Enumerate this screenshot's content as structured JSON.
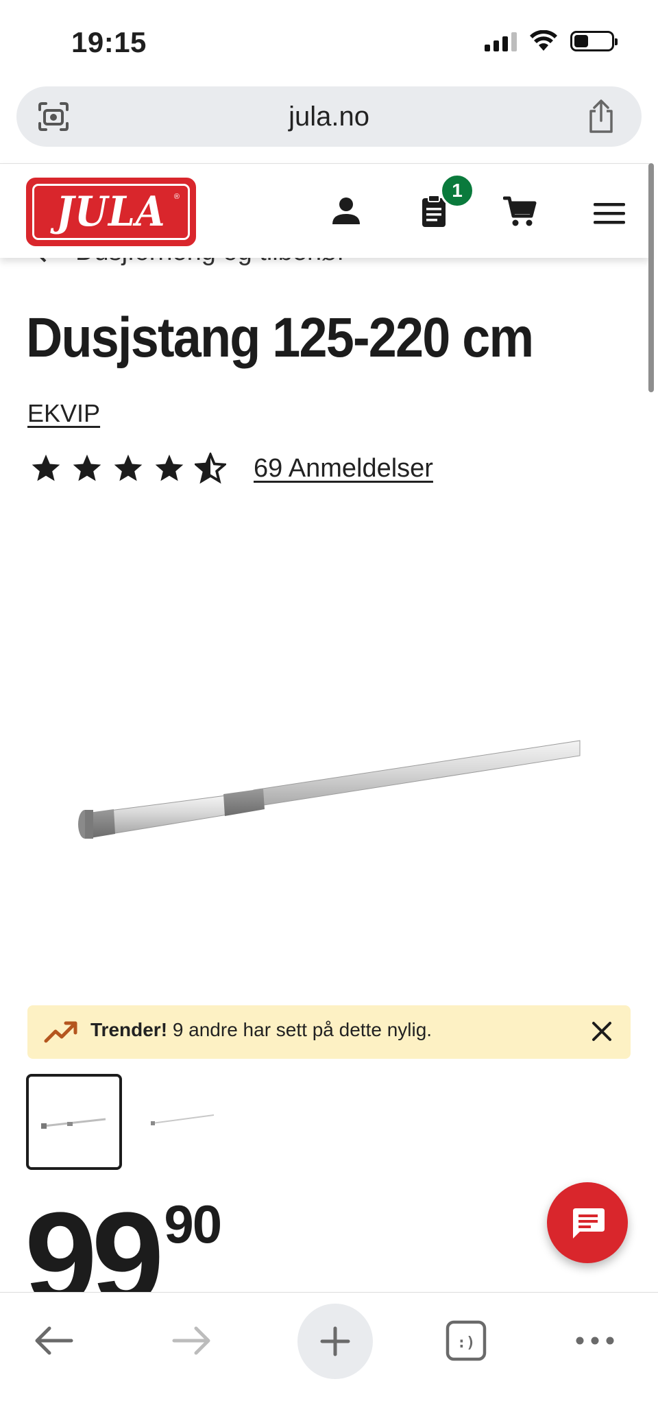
{
  "status": {
    "time": "19:15"
  },
  "browser": {
    "url": "jula.no"
  },
  "header": {
    "logo_text": "JULA",
    "list_badge_count": "1"
  },
  "breadcrumb": {
    "label": "Dusjforheng og tilbehør"
  },
  "product": {
    "title": "Dusjstang 125-220 cm",
    "brand": "EKVIP",
    "rating": 4.5,
    "reviews_label": "69 Anmeldelser",
    "price_main": "99",
    "price_decimals": "90"
  },
  "trend": {
    "bold": "Trender!",
    "text": "9 andre har sett på dette nylig."
  },
  "icons": {
    "header": [
      "user-icon",
      "shopping-list-icon",
      "cart-icon",
      "menu-icon"
    ],
    "toolbar": [
      "back-arrow-icon",
      "forward-arrow-icon",
      "plus-icon",
      "tabs-icon",
      "more-icon"
    ]
  },
  "colors": {
    "brand_red": "#d9262c",
    "badge_green": "#0a7a3c",
    "trend_bg": "#fdf1c4",
    "trend_icon": "#b4561f"
  }
}
